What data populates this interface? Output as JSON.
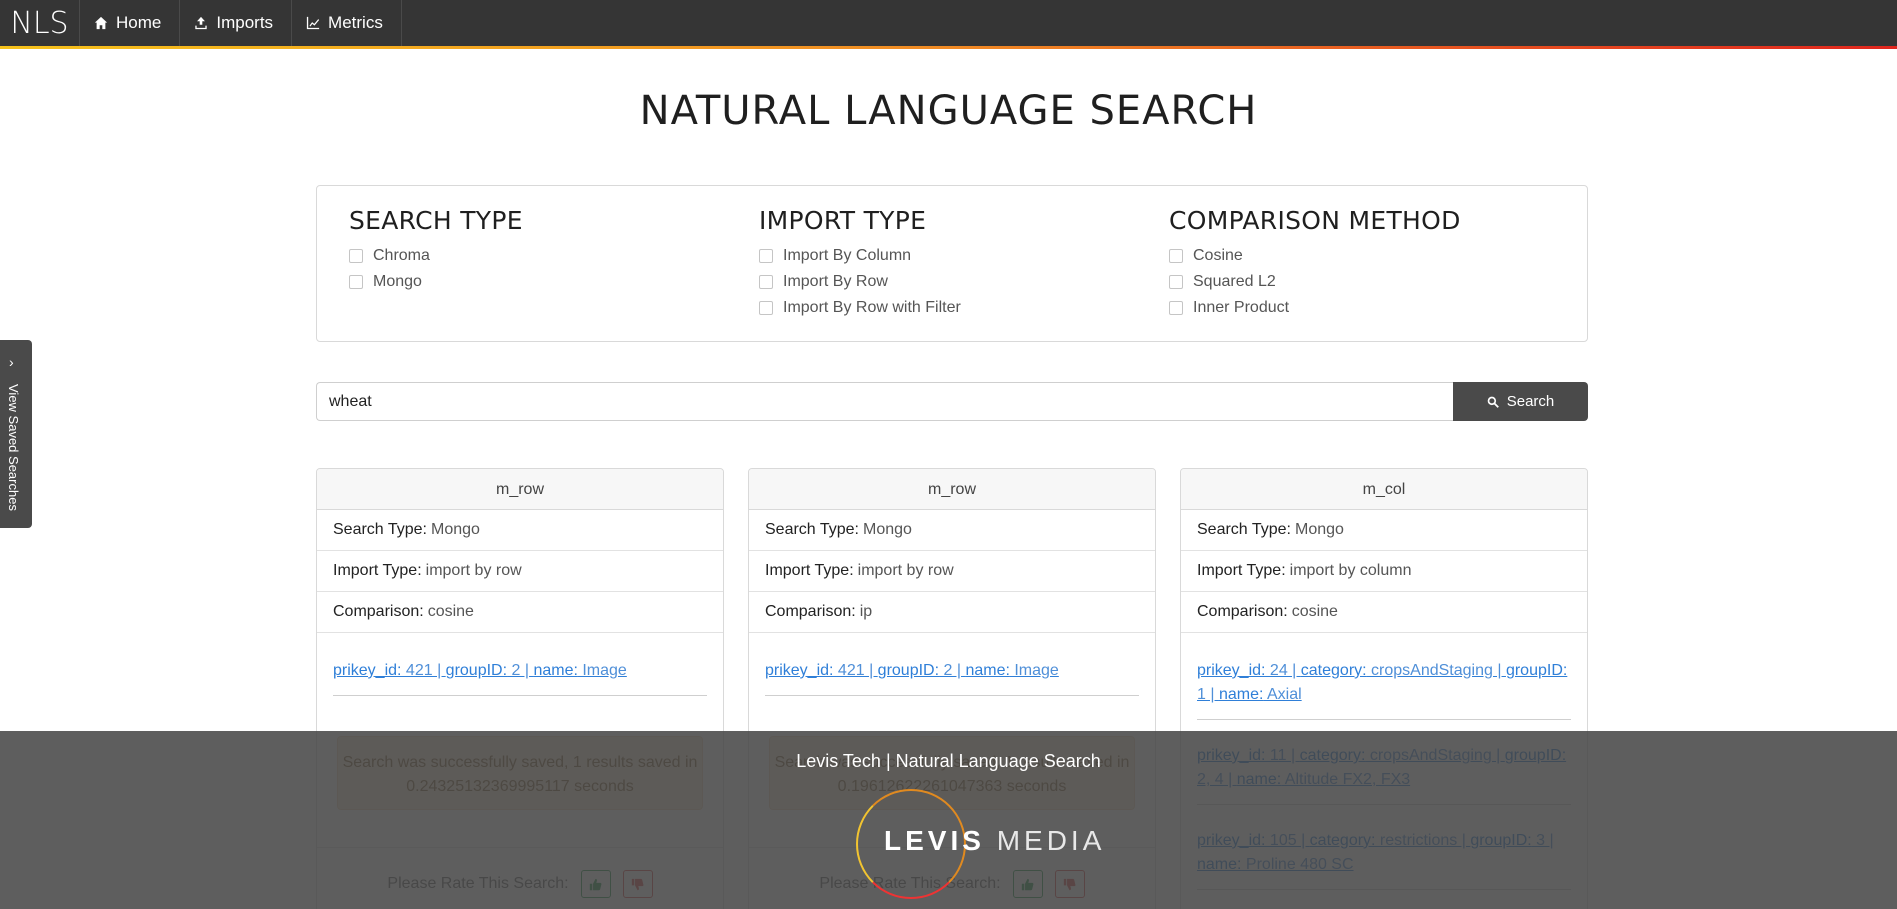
{
  "navbar": {
    "brand": "NLS",
    "items": [
      {
        "label": "Home",
        "icon": "home-icon"
      },
      {
        "label": "Imports",
        "icon": "upload-icon"
      },
      {
        "label": "Metrics",
        "icon": "chart-line-icon"
      }
    ]
  },
  "page_title": "NATURAL LANGUAGE SEARCH",
  "options": {
    "search_type": {
      "heading": "SEARCH TYPE",
      "items": [
        "Chroma",
        "Mongo"
      ]
    },
    "import_type": {
      "heading": "IMPORT TYPE",
      "items": [
        "Import By Column",
        "Import By Row",
        "Import By Row with Filter"
      ]
    },
    "comparison_method": {
      "heading": "COMPARISON METHOD",
      "items": [
        "Cosine",
        "Squared L2",
        "Inner Product"
      ]
    }
  },
  "search": {
    "value": "wheat",
    "button_label": "Search"
  },
  "side_tab": {
    "label": "View Saved Searches"
  },
  "labels": {
    "search_type": "Search Type:",
    "import_type": "Import Type:",
    "comparison": "Comparison:",
    "rate": "Please Rate This Search:"
  },
  "cards": [
    {
      "title": "m_row",
      "search_type": "Mongo",
      "import_type": "import by row",
      "comparison": "cosine",
      "results": [
        {
          "parts": [
            [
              "prikey_id:",
              " 421 | "
            ],
            [
              "groupID:",
              " 2 | "
            ],
            [
              "name:",
              " Image"
            ]
          ]
        }
      ],
      "saved_message": "Search was successfully saved, 1 results saved in 0.24325132369995117 seconds"
    },
    {
      "title": "m_row",
      "search_type": "Mongo",
      "import_type": "import by row",
      "comparison": "ip",
      "results": [
        {
          "parts": [
            [
              "prikey_id:",
              " 421 | "
            ],
            [
              "groupID:",
              " 2 | "
            ],
            [
              "name:",
              " Image"
            ]
          ]
        }
      ],
      "saved_message": "Search was successfully saved, 1 results saved in 0.19612622261047363 seconds"
    },
    {
      "title": "m_col",
      "search_type": "Mongo",
      "import_type": "import by column",
      "comparison": "cosine",
      "results": [
        {
          "parts": [
            [
              "prikey_id:",
              " 24 | "
            ],
            [
              "category:",
              " cropsAndStaging | "
            ],
            [
              "groupID:",
              " 1 | "
            ],
            [
              "name:",
              " Axial"
            ]
          ]
        },
        {
          "parts": [
            [
              "prikey_id:",
              " 11 | "
            ],
            [
              "category:",
              " cropsAndStaging | "
            ],
            [
              "groupID:",
              " 2, 4 | "
            ],
            [
              "name:",
              " Altitude FX2, FX3"
            ]
          ]
        },
        {
          "parts": [
            [
              "prikey_id:",
              " 105 | "
            ],
            [
              "category:",
              " restrictions | "
            ],
            [
              "groupID:",
              " 3 | "
            ],
            [
              "name:",
              " Proline 480 SC"
            ]
          ]
        }
      ],
      "saved_message": ""
    }
  ],
  "overlay": {
    "caption": "Levis Tech | Natural Language Search",
    "logo_bold": "LEVIS",
    "logo_light": "MEDIA"
  },
  "colors": {
    "navbar_bg": "#353535",
    "accent_gradient": [
      "#f6c21b",
      "#f08a24",
      "#e0261e"
    ],
    "link": "#2f7fd8",
    "button_dark": "#4a4a4a"
  }
}
